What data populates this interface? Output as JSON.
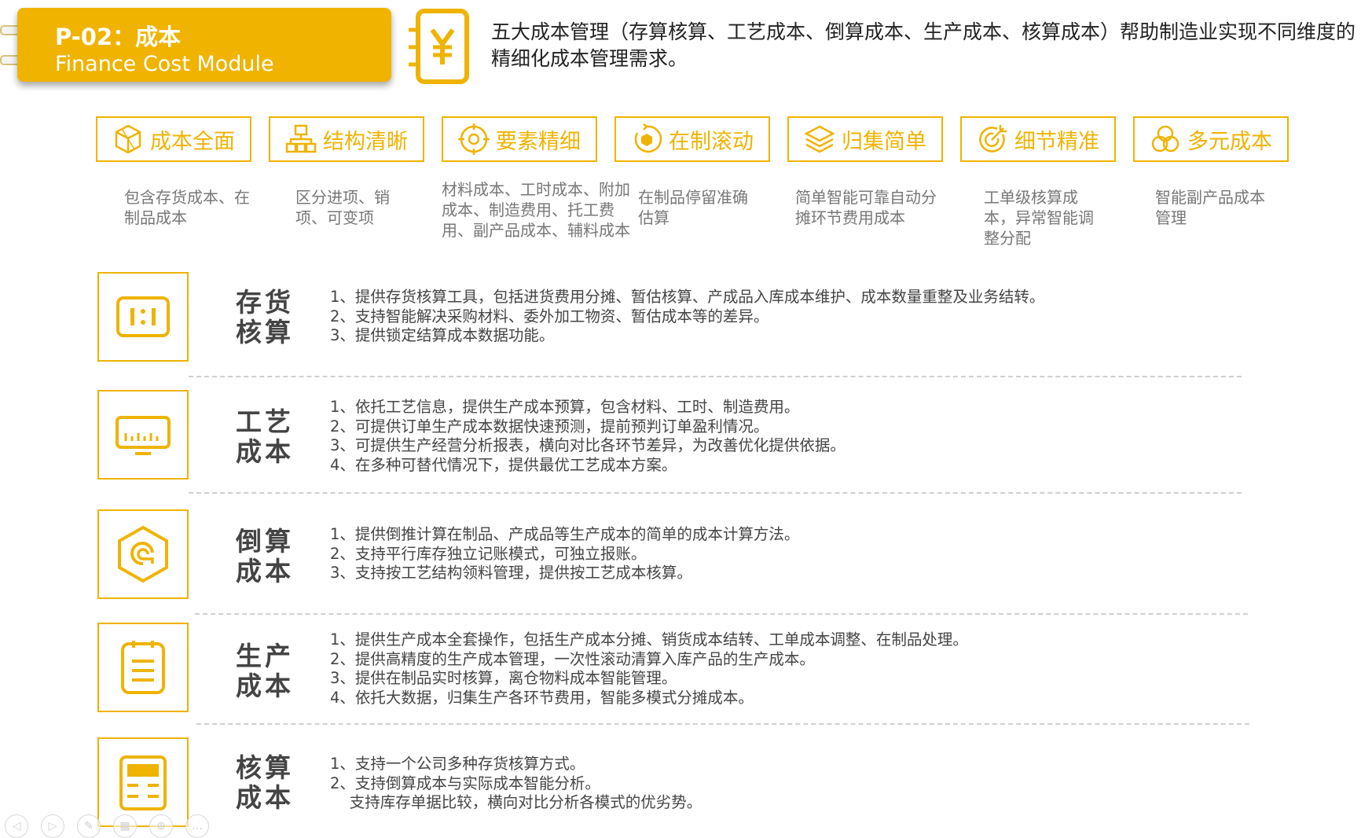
{
  "header": {
    "code": "P-02：成本",
    "subtitle": "Finance Cost Module",
    "intro": "五大成本管理（存算核算、工艺成本、倒算成本、生产成本、核算成本）帮助制造业实现不同维度的精细化成本管理需求。"
  },
  "features": [
    {
      "label": "成本全面",
      "icon": "cube-icon",
      "desc": "包含存货成本、在制品成本"
    },
    {
      "label": "结构清晰",
      "icon": "org-chart-icon",
      "desc": "区分进项、销项、可变项"
    },
    {
      "label": "要素精细",
      "icon": "target-icon",
      "desc": "材料成本、工时成本、附加成本、制造费用、托工费用、副产品成本、辅料成本"
    },
    {
      "label": "在制滚动",
      "icon": "rotate-box-icon",
      "desc": "在制品停留准确估算"
    },
    {
      "label": "归集简单",
      "icon": "layers-icon",
      "desc": "简单智能可靠自动分摊环节费用成本"
    },
    {
      "label": "细节精准",
      "icon": "bullseye-icon",
      "desc": "工单级核算成本，异常智能调整分配"
    },
    {
      "label": "多元成本",
      "icon": "network-icon",
      "desc": "智能副产品成本管理"
    }
  ],
  "sections": [
    {
      "title": "存货核算",
      "icon": "ratio-icon",
      "lines": [
        "1、提供存货核算工具，包括进货费用分摊、暂估核算、产成品入库成本维护、成本数量重整及业务结转。",
        "2、支持智能解决采购材料、委外加工物资、暂估成本等的差异。",
        "3、提供锁定结算成本数据功能。"
      ]
    },
    {
      "title": "工艺成本",
      "icon": "ruler-icon",
      "lines": [
        "1、依托工艺信息，提供生产成本预算，包含材料、工时、制造费用。",
        "2、可提供订单生产成本数据快速预测，提前预判订单盈利情况。",
        "3、可提供生产经营分析报表，横向对比各环节差异，为改善优化提供依据。",
        "4、在多种可替代情况下，提供最优工艺成本方案。"
      ]
    },
    {
      "title": "倒算成本",
      "icon": "hexagon-undo-icon",
      "lines": [
        "1、提供倒推计算在制品、产成品等生产成本的简单的成本计算方法。",
        "2、支持平行库存独立记账模式，可独立报账。",
        "3、支持按工艺结构领料管理，提供按工艺成本核算。"
      ]
    },
    {
      "title": "生产成本",
      "icon": "clipboard-icon",
      "lines": [
        "1、提供生产成本全套操作，包括生产成本分摊、销货成本结转、工单成本调整、在制品处理。",
        "2、提供高精度的生产成本管理，一次性滚动清算入库产品的生产成本。",
        "3、提供在制品实时核算，离仓物料成本智能管理。",
        "4、依托大数据，归集生产各环节费用，智能多模式分摊成本。"
      ]
    },
    {
      "title": "核算成本",
      "icon": "calculator-icon",
      "lines": [
        "1、支持一个公司多种存货核算方式。",
        "2、支持倒算成本与实际成本智能分析。",
        "    支持库存单据比较，横向对比分析各模式的优劣势。"
      ]
    }
  ],
  "viewer_controls": [
    {
      "name": "prev-slide-button",
      "icon": "chevron-left-icon",
      "glyph": "◁"
    },
    {
      "name": "next-slide-button",
      "icon": "chevron-right-icon",
      "glyph": "▷"
    },
    {
      "name": "pen-button",
      "icon": "pen-icon",
      "glyph": "✎"
    },
    {
      "name": "slides-button",
      "icon": "grid-icon",
      "glyph": "▦"
    },
    {
      "name": "zoom-button",
      "icon": "magnifier-icon",
      "glyph": "⊕"
    },
    {
      "name": "more-button",
      "icon": "more-icon",
      "glyph": "…"
    }
  ],
  "colors": {
    "accent": "#efb300",
    "text": "#444444",
    "muted": "#777777"
  }
}
